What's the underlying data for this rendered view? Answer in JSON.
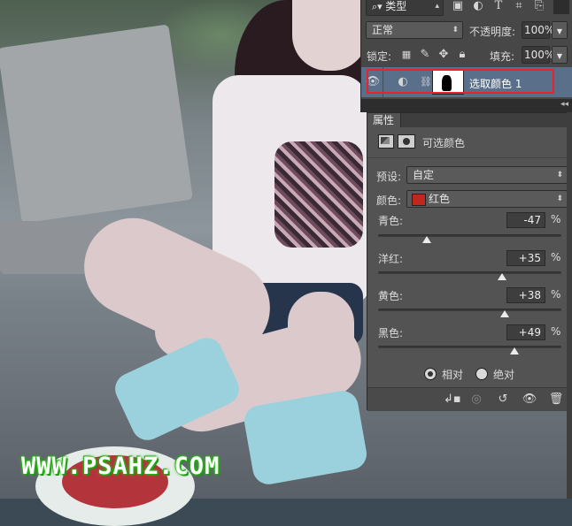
{
  "layers_panel": {
    "filter_label": "类型",
    "blend_mode": "正常",
    "opacity_label": "不透明度:",
    "opacity_value": "100%",
    "lock_label": "锁定:",
    "fill_label": "填充:",
    "fill_value": "100%",
    "layer": {
      "name": "选取颜色 1"
    }
  },
  "properties_panel": {
    "tab_label": "属性",
    "title": "可选颜色",
    "preset_label": "预设:",
    "preset_value": "自定",
    "colors_label": "颜色:",
    "colors_value": "红色",
    "colors_swatch": "#c0281e",
    "sliders": [
      {
        "label": "青色:",
        "value": "-47",
        "unit": "%",
        "level": -0.47
      },
      {
        "label": "洋红:",
        "value": "+35",
        "unit": "%",
        "level": 0.35
      },
      {
        "label": "黄色:",
        "value": "+38",
        "unit": "%",
        "level": 0.38
      },
      {
        "label": "黑色:",
        "value": "+49",
        "unit": "%",
        "level": 0.49
      }
    ],
    "method": {
      "relative_label": "相对",
      "absolute_label": "绝对",
      "selected": "relative"
    }
  },
  "watermark": "WWW.PSAHZ.COM",
  "colors": {
    "highlight_border": "#e8232b",
    "selected_layer": "#596f8a",
    "panel_bg": "#535353"
  }
}
